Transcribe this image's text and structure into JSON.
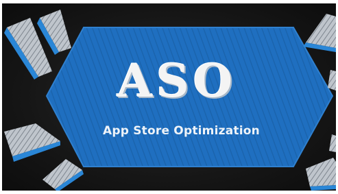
{
  "banner": {
    "headline": "ASO",
    "subline": "App Store Optimization"
  },
  "colors": {
    "banner_blue": "#1f6fc0",
    "banner_blue_dark": "#1558a0",
    "board": "#161616",
    "chalk": "#f4f4f4",
    "ray_blue": "#2a86d6",
    "ray_chalk": "#d9dde2"
  }
}
